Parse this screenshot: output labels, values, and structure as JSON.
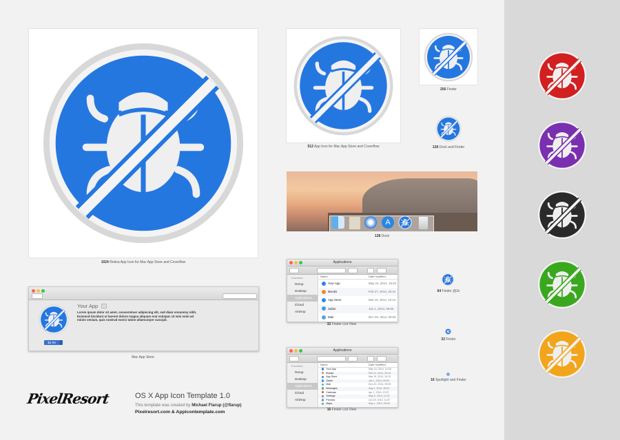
{
  "captions": {
    "c1024": {
      "size": "1024",
      "text": "Retina App Icon for Mac App Store and Coverflow"
    },
    "c512": {
      "size": "512",
      "text": "App Icon for Mac App Store and Coverflow"
    },
    "c256": {
      "size": "256",
      "text": "Finder"
    },
    "c128": {
      "size": "128",
      "text": "Dock and Finder"
    },
    "c128dock": {
      "size": "128",
      "text": "Dock"
    },
    "c64": {
      "size": "64",
      "text": "Finder @2x"
    },
    "c32": {
      "size": "32",
      "text": "Finder"
    },
    "c32list": {
      "size": "32",
      "text": "Finder List View"
    },
    "c16": {
      "size": "16",
      "text": "Spotlight and Finder"
    },
    "c16list": {
      "size": "16",
      "text": "Finder List View"
    },
    "mas": {
      "text": "Mac App Store"
    }
  },
  "appstore": {
    "app_name": "Your App",
    "description": "Lorem ipsum dolor sit amet, consectetuer adipiscing elit, sed diam nonummy nibh. Euismod tincidunt ut laoreet dolore magna aliquam erat volutpat. Ut wisi enim ad minim veniam, quis nostrud exerci tation ullamcorper suscipit.",
    "price": "$2.99"
  },
  "finder": {
    "title": "Applications",
    "sidebar_head": "Favorites",
    "sidebar": [
      "Rerup",
      "Desktop",
      "Applications",
      "iCloud",
      "AirDrop"
    ],
    "col_name": "Name",
    "col_date": "Date modified",
    "rows32": [
      {
        "name": "Your App",
        "date": "May 24, 2014, 19:26",
        "color": "#2f80e6"
      },
      {
        "name": "iBooks",
        "date": "Feb 27, 2014, 20:44",
        "color": "#f08a1c"
      },
      {
        "name": "App Store",
        "date": "Mar 10, 2014, 10:13",
        "color": "#2a8ae6"
      },
      {
        "name": "Safari",
        "date": "Jan 1, 2014, 09:00",
        "color": "#3a9ae8"
      },
      {
        "name": "Mail",
        "date": "Dec 20, 2014, 09:00",
        "color": "#5aa0e0"
      }
    ],
    "rows16": [
      {
        "name": "Your App",
        "date": "May 24, 2014, 19:26",
        "color": "#2f80e6"
      },
      {
        "name": "iBooks",
        "date": "Feb 21, 2014, 20:44",
        "color": "#f08a1c"
      },
      {
        "name": "App Store",
        "date": "Mar 10, 2014, 10:13",
        "color": "#2a8ae6"
      },
      {
        "name": "Safari",
        "date": "Jan 1, 2014, 09:00",
        "color": "#3a9ae8"
      },
      {
        "name": "Mail",
        "date": "Dec 20, 2014, 09:00",
        "color": "#5aa0e0"
      },
      {
        "name": "Messages",
        "date": "Aug 2, 2014, 08:42",
        "color": "#4bc04b"
      },
      {
        "name": "Calendar",
        "date": "Apr 1, 2014, 13:37",
        "color": "#e34a3a"
      },
      {
        "name": "Settings",
        "date": "May 5, 2014, 11:32",
        "color": "#8a8a8a"
      },
      {
        "name": "Preview",
        "date": "Oct 25, 2013, 11:57",
        "color": "#6a9ad0"
      },
      {
        "name": "Maps",
        "date": "May 1, 2013, 09:00",
        "color": "#5ab85a"
      }
    ]
  },
  "footer": {
    "brand": "PixelResort",
    "title": "OS X App Icon Template 1.0",
    "created_prefix": "This template was created by ",
    "author": "Michael Flarup (@flarup)",
    "sites": "Pixelresort.com & Appicontemplate.com"
  },
  "icon_colors": {
    "blue": "#2f80e6",
    "variants": [
      "#d21f1f",
      "#7a2fb0",
      "#2a2a2a",
      "#3aa81e",
      "#f2a51a"
    ]
  },
  "icons": {
    "bug": "bug-icon",
    "prohibited": "prohibited-slash-icon"
  }
}
